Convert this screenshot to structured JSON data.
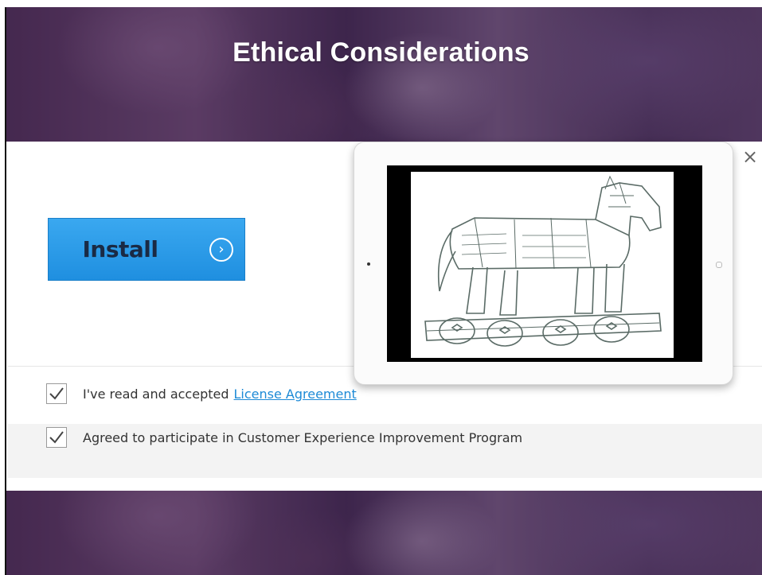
{
  "slide": {
    "title": "Ethical Considerations"
  },
  "installer": {
    "install_label": "Install",
    "arrow_icon": "chevron-right-circle-icon",
    "close_glyph": "×",
    "agreement": {
      "checked": true,
      "text": "I've read and accepted",
      "link_text": "License Agreement"
    },
    "program": {
      "checked": true,
      "text": "Agreed to participate in Customer Experience Improvement Program"
    }
  },
  "tablet": {
    "image_subject": "trojan-horse-sketch-icon"
  },
  "colors": {
    "install_button": "#2196e8",
    "link": "#1d8ad6",
    "background_tint": "#4a2f4f"
  }
}
